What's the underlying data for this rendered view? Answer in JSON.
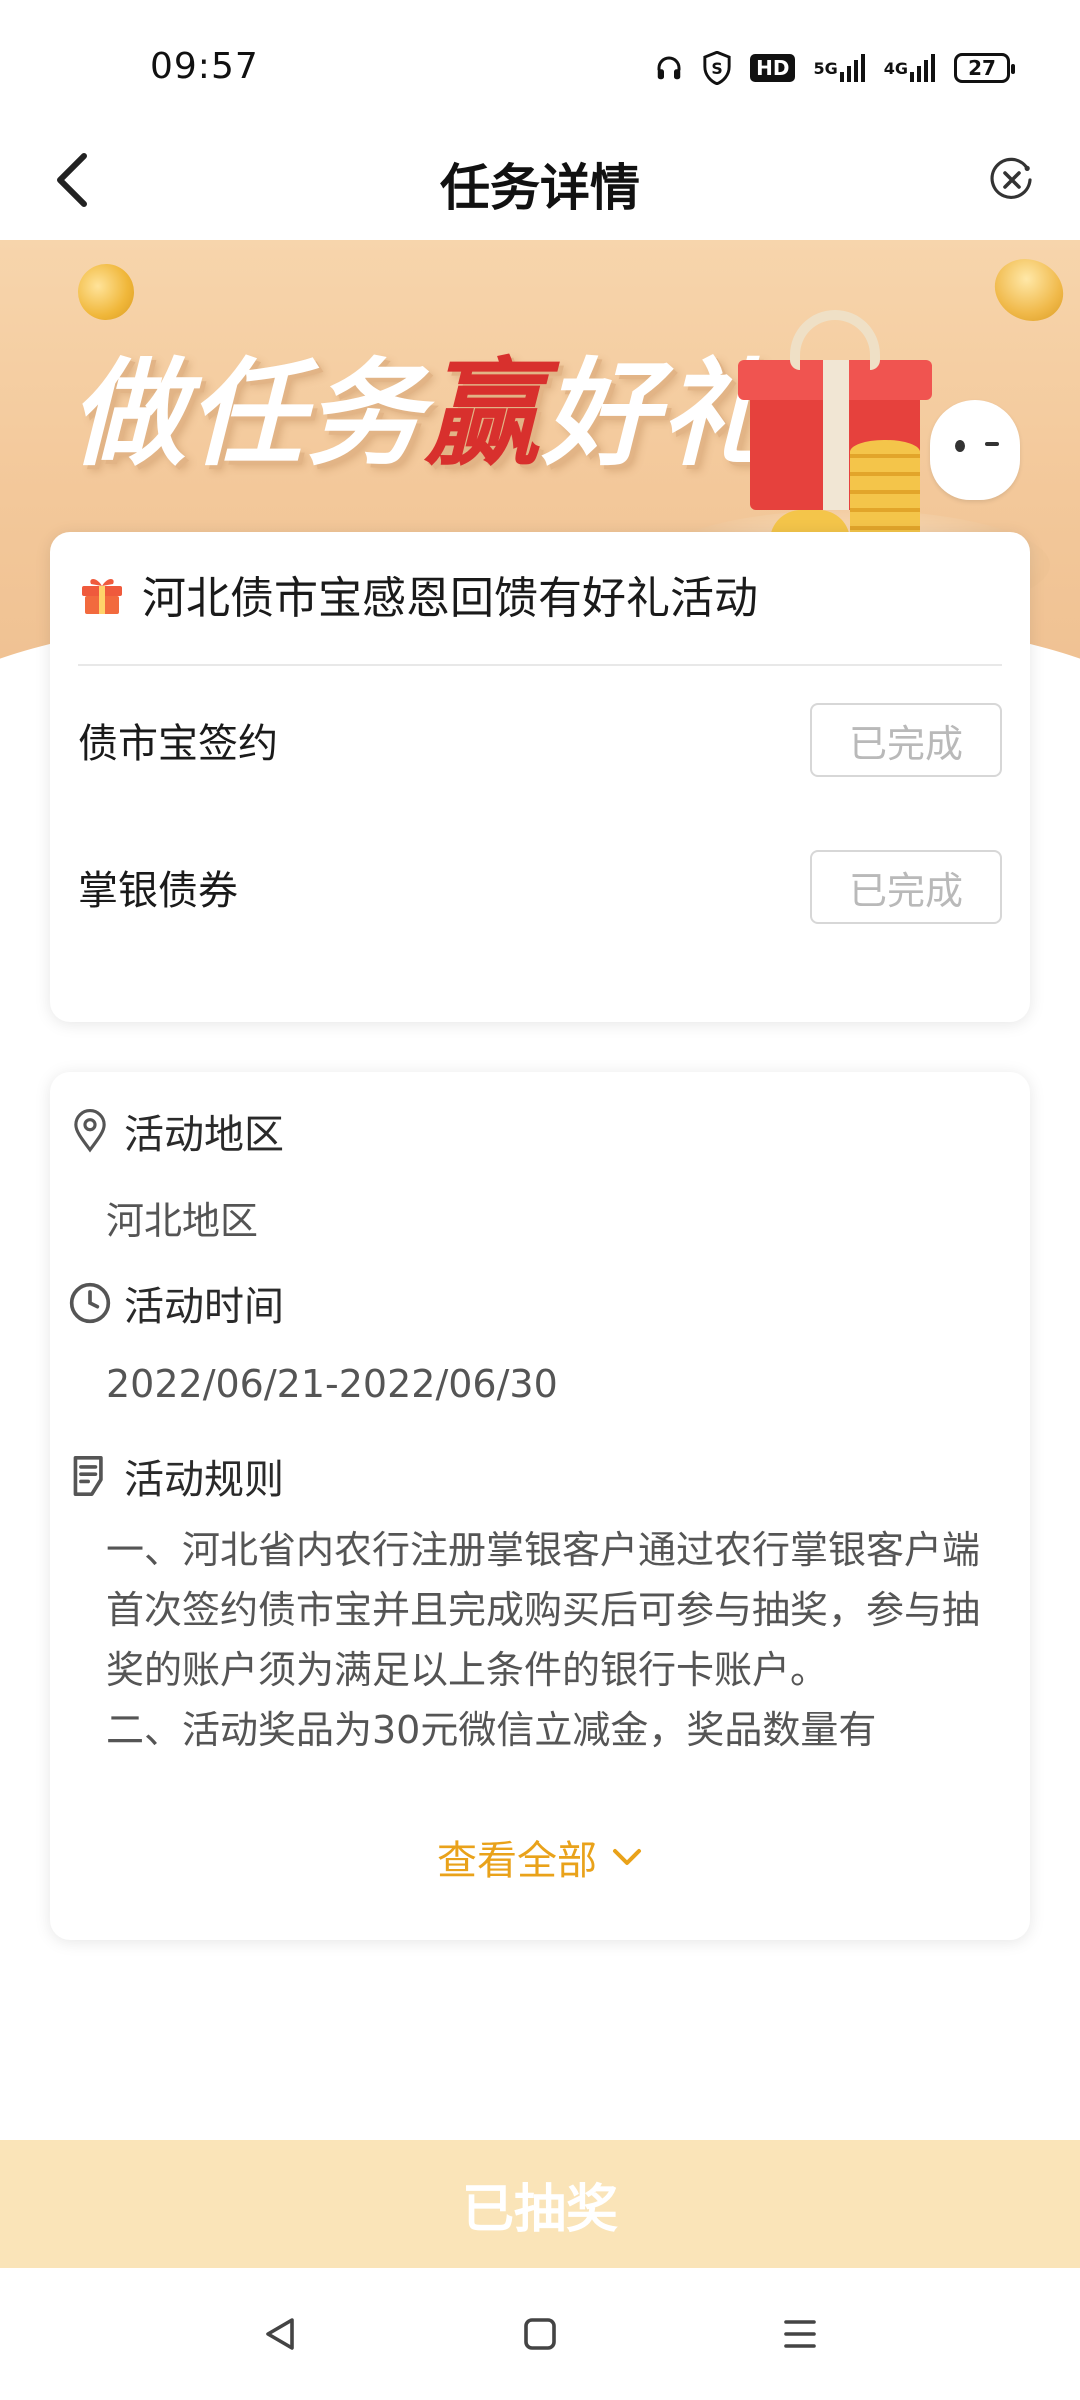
{
  "status_bar": {
    "time": "09:57",
    "hd_label": "HD",
    "net5g": "5G",
    "net4g": "4G",
    "battery": "27"
  },
  "header": {
    "title": "任务详情",
    "back_icon": "chevron-left-icon",
    "close_icon": "close-circle-icon"
  },
  "banner": {
    "title_part1": "做任务",
    "title_highlight": "赢",
    "title_part2": "好礼",
    "highlight_color": "#d8302d"
  },
  "task_card": {
    "title": "河北债市宝感恩回馈有好礼活动",
    "tasks": [
      {
        "label": "债市宝签约",
        "status": "已完成"
      },
      {
        "label": "掌银债券",
        "status": "已完成"
      }
    ]
  },
  "info_card": {
    "region": {
      "label": "活动地区",
      "value": "河北地区"
    },
    "time": {
      "label": "活动时间",
      "value": "2022/06/21-2022/06/30"
    },
    "rules": {
      "label": "活动规则",
      "paragraph1": "一、河北省内农行注册掌银客户通过农行掌银客户端首次签约债市宝并且完成购买后可参与抽奖，参与抽奖的账户须为满足以上条件的银行卡账户。",
      "paragraph2": "二、活动奖品为30元微信立减金，奖品数量有"
    },
    "view_all": "查看全部",
    "accent_color": "#e9a21a"
  },
  "bottom_action": {
    "label": "已抽奖",
    "bg_color": "#fae4b8"
  },
  "system_nav": {
    "back": "triangle-back-icon",
    "home": "square-home-icon",
    "menu": "menu-lines-icon"
  }
}
